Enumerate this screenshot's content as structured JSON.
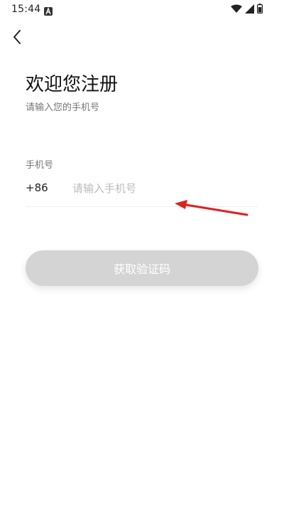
{
  "status_bar": {
    "time": "15:44",
    "icons": [
      "a-notification-icon",
      "wifi-icon",
      "signal-icon",
      "battery-icon"
    ]
  },
  "header": {
    "back_icon": "chevron-left-icon"
  },
  "main": {
    "title": "欢迎您注册",
    "subtitle": "请输入您的手机号",
    "phone_label": "手机号",
    "country_code": "+86",
    "phone_placeholder": "请输入手机号",
    "phone_value": "",
    "submit_label": "获取验证码"
  },
  "annotation": {
    "arrow_color": "#e02020"
  },
  "colors": {
    "button_disabled_bg": "#d4d4d4",
    "button_text": "#ffffff",
    "muted_text": "#777777",
    "placeholder": "#bbbbbb"
  }
}
